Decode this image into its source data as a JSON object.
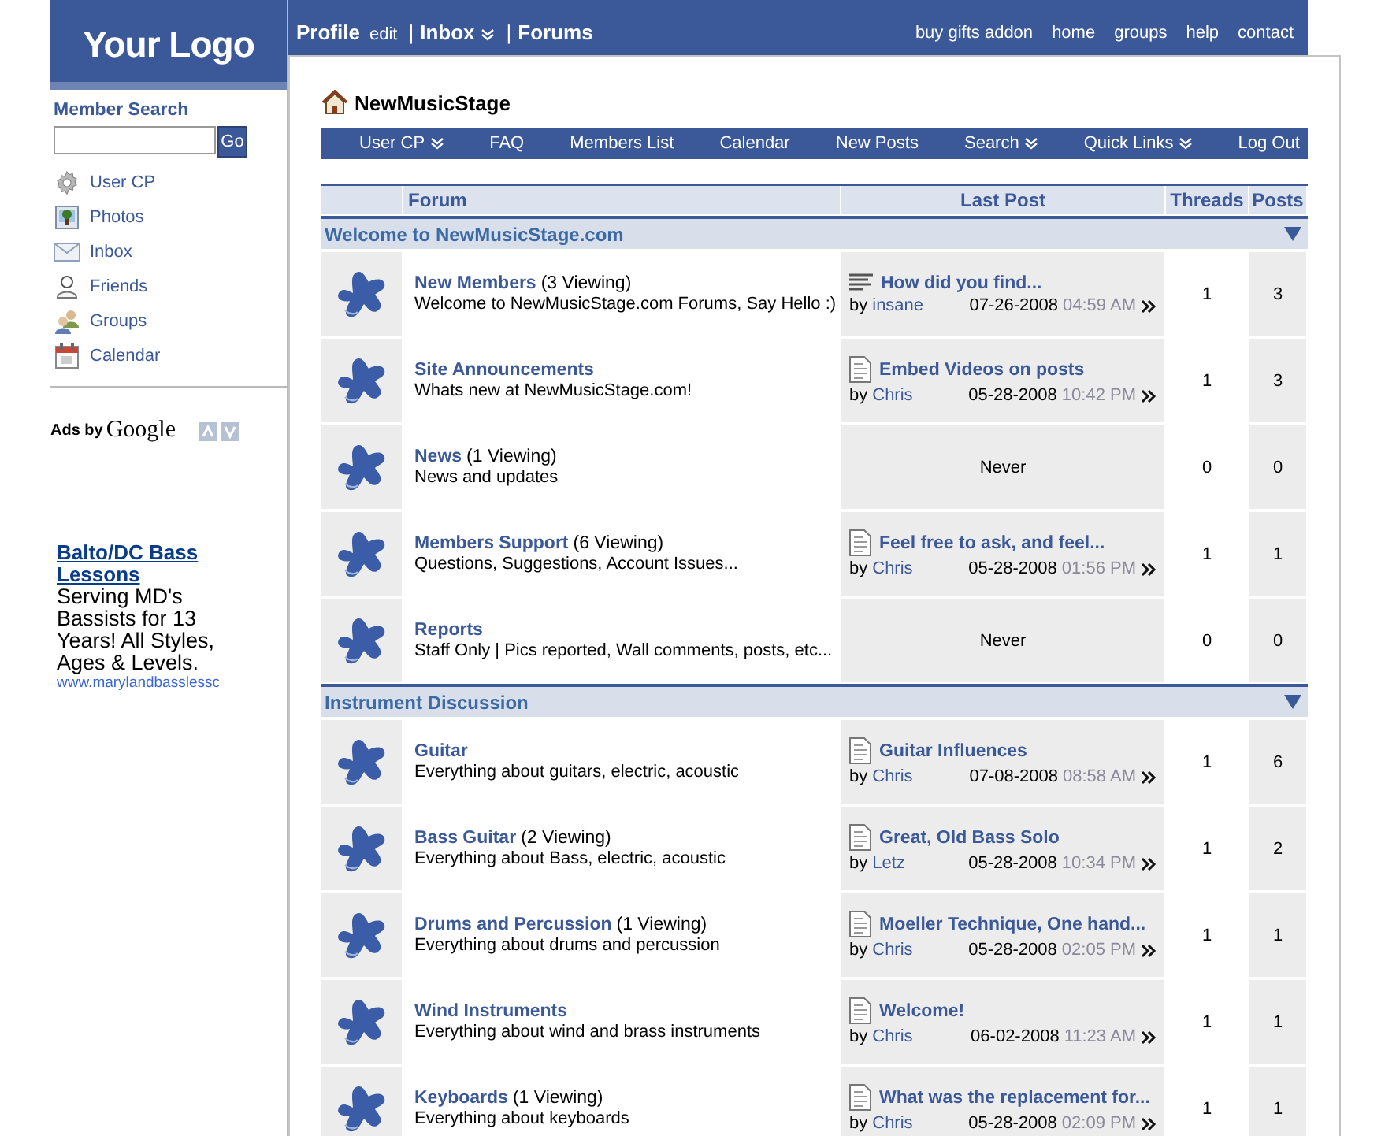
{
  "logo": "Your Logo",
  "top_nav": {
    "left": [
      {
        "label": "Profile",
        "kind": "main",
        "dropdown": false
      },
      {
        "label": "edit",
        "kind": "small",
        "dropdown": false
      },
      {
        "label": "|",
        "kind": "separator",
        "dropdown": false
      },
      {
        "label": "Inbox",
        "kind": "main",
        "dropdown": true
      },
      {
        "label": "|",
        "kind": "separator",
        "dropdown": false
      },
      {
        "label": "Forums",
        "kind": "main",
        "dropdown": false
      }
    ],
    "right": [
      "buy gifts addon",
      "home",
      "groups",
      "help",
      "contact"
    ]
  },
  "sidebar": {
    "search_title": "Member Search",
    "search_button": "Go",
    "items": [
      "User CP",
      "Photos",
      "Inbox",
      "Friends",
      "Groups",
      "Calendar"
    ],
    "ads_label": "Ads by",
    "ads_brand": "Google",
    "ad": {
      "title": "Balto/DC Bass Lessons",
      "body": "Serving MD's Bassists for 13 Years! All Styles, Ages & Levels.",
      "url": "www.marylandbasslessc"
    }
  },
  "site_title": "NewMusicStage",
  "nav": [
    {
      "label": "User CP",
      "dropdown": true
    },
    {
      "label": "FAQ",
      "dropdown": false
    },
    {
      "label": "Members List",
      "dropdown": false
    },
    {
      "label": "Calendar",
      "dropdown": false
    },
    {
      "label": "New Posts",
      "dropdown": false
    },
    {
      "label": "Search",
      "dropdown": true
    },
    {
      "label": "Quick Links",
      "dropdown": true
    },
    {
      "label": "Log Out",
      "dropdown": false
    }
  ],
  "table": {
    "columns": [
      "Forum",
      "Last Post",
      "Threads",
      "Posts"
    ],
    "sections": [
      {
        "title": "Welcome to NewMusicStage.com",
        "forums": [
          {
            "name": "New Members",
            "viewing": "(3 Viewing)",
            "description": "Welcome to NewMusicStage.com Forums, Say Hello :)",
            "last_post": {
              "kind": "post",
              "title": "How did you find...",
              "by_prefix": "by",
              "by": "insane",
              "date": "07-26-2008",
              "time": "04:59 AM"
            },
            "threads": "1",
            "posts": "3"
          },
          {
            "name": "Site Announcements",
            "description": "Whats new at NewMusicStage.com!",
            "last_post": {
              "kind": "post",
              "title": "Embed Videos on posts",
              "by_prefix": "by",
              "by": "Chris",
              "date": "05-28-2008",
              "time": "10:42 PM"
            },
            "threads": "1",
            "posts": "3"
          },
          {
            "name": "News",
            "viewing": "(1 Viewing)",
            "description": "News and updates",
            "last_post": {
              "kind": "none",
              "text": "Never"
            },
            "threads": "0",
            "posts": "0"
          },
          {
            "name": "Members Support",
            "viewing": "(6 Viewing)",
            "description": "Questions, Suggestions, Account Issues...",
            "last_post": {
              "kind": "post",
              "title": "Feel free to ask, and feel...",
              "by_prefix": "by",
              "by": "Chris",
              "date": "05-28-2008",
              "time": "01:56 PM"
            },
            "threads": "1",
            "posts": "1"
          },
          {
            "name": "Reports",
            "description": "Staff Only | Pics reported, Wall comments, posts, etc...",
            "last_post": {
              "kind": "none",
              "text": "Never"
            },
            "threads": "0",
            "posts": "0"
          }
        ]
      },
      {
        "title": "Instrument Discussion",
        "forums": [
          {
            "name": "Guitar",
            "description": "Everything about guitars, electric, acoustic",
            "last_post": {
              "kind": "post",
              "title": "Guitar Influences",
              "by_prefix": "by",
              "by": "Chris",
              "date": "07-08-2008",
              "time": "08:58 AM"
            },
            "threads": "1",
            "posts": "6"
          },
          {
            "name": "Bass Guitar",
            "viewing": "(2 Viewing)",
            "description": "Everything about Bass, electric, acoustic",
            "last_post": {
              "kind": "post",
              "title": "Great, Old Bass Solo",
              "by_prefix": "by",
              "by": "Letz",
              "date": "05-28-2008",
              "time": "10:34 PM"
            },
            "threads": "1",
            "posts": "2"
          },
          {
            "name": "Drums and Percussion",
            "viewing": "(1 Viewing)",
            "description": "Everything about drums and percussion",
            "last_post": {
              "kind": "post",
              "title": "Moeller Technique, One hand...",
              "by_prefix": "by",
              "by": "Chris",
              "date": "05-28-2008",
              "time": "02:05 PM"
            },
            "threads": "1",
            "posts": "1"
          },
          {
            "name": "Wind Instruments",
            "description": "Everything about wind and brass instruments",
            "last_post": {
              "kind": "post",
              "title": "Welcome!",
              "by_prefix": "by",
              "by": "Chris",
              "date": "06-02-2008",
              "time": "11:23 AM"
            },
            "threads": "1",
            "posts": "1"
          },
          {
            "name": "Keyboards",
            "viewing": "(1 Viewing)",
            "description": "Everything about keyboards",
            "last_post": {
              "kind": "post",
              "title": "What was the replacement for...",
              "by_prefix": "by",
              "by": "Chris",
              "date": "05-28-2008",
              "time": "02:09 PM"
            },
            "threads": "1",
            "posts": "1"
          }
        ]
      }
    ]
  }
}
